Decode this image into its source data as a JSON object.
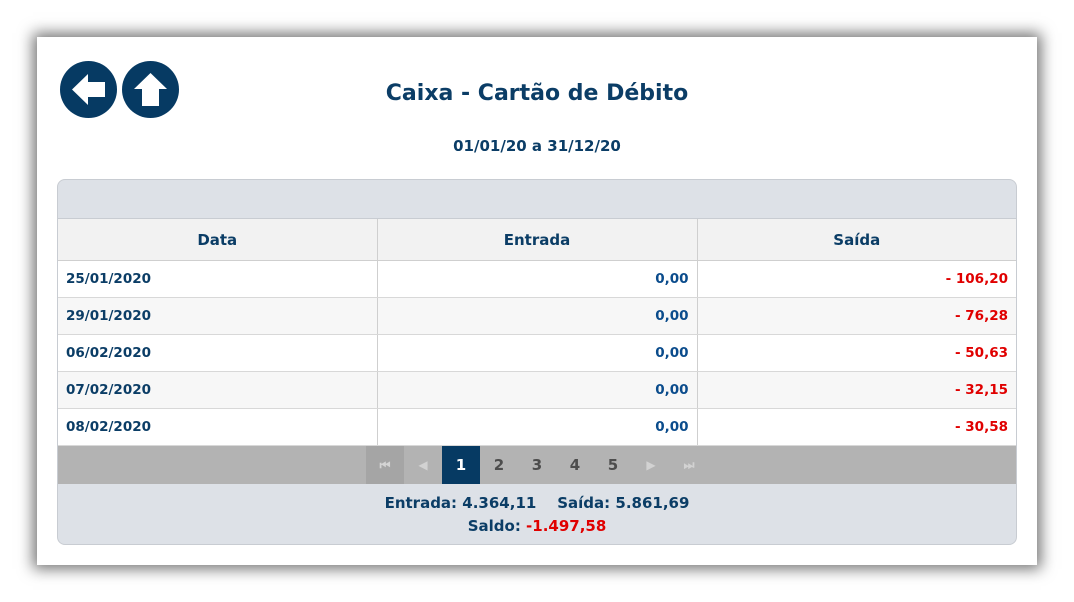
{
  "header": {
    "title": "Caixa - Cartão de Débito",
    "period": "01/01/20 a 31/12/20",
    "back_icon": "arrow-left-icon",
    "home_icon": "arrow-up-icon"
  },
  "grid": {
    "columns": [
      "Data",
      "Entrada",
      "Saída"
    ],
    "rows": [
      {
        "data": "25/01/2020",
        "entrada": "0,00",
        "saida": "- 106,20"
      },
      {
        "data": "29/01/2020",
        "entrada": "0,00",
        "saida": "- 76,28"
      },
      {
        "data": "06/02/2020",
        "entrada": "0,00",
        "saida": "- 50,63"
      },
      {
        "data": "07/02/2020",
        "entrada": "0,00",
        "saida": "- 32,15"
      },
      {
        "data": "08/02/2020",
        "entrada": "0,00",
        "saida": "- 30,58"
      }
    ]
  },
  "pager": {
    "pages": [
      "1",
      "2",
      "3",
      "4",
      "5"
    ],
    "current": "1",
    "first_icon": "first-page-icon",
    "prev_icon": "previous-page-icon",
    "next_icon": "next-page-icon",
    "last_icon": "last-page-icon"
  },
  "totals": {
    "entrada_label": "Entrada:",
    "entrada_value": "4.364,11",
    "saida_label": "Saída:",
    "saida_value": "5.861,69",
    "saldo_label": "Saldo:",
    "saldo_value": "-1.497,58"
  },
  "colors": {
    "primary": "#063a63",
    "negative": "#e00000",
    "panel": "#dde1e7"
  }
}
